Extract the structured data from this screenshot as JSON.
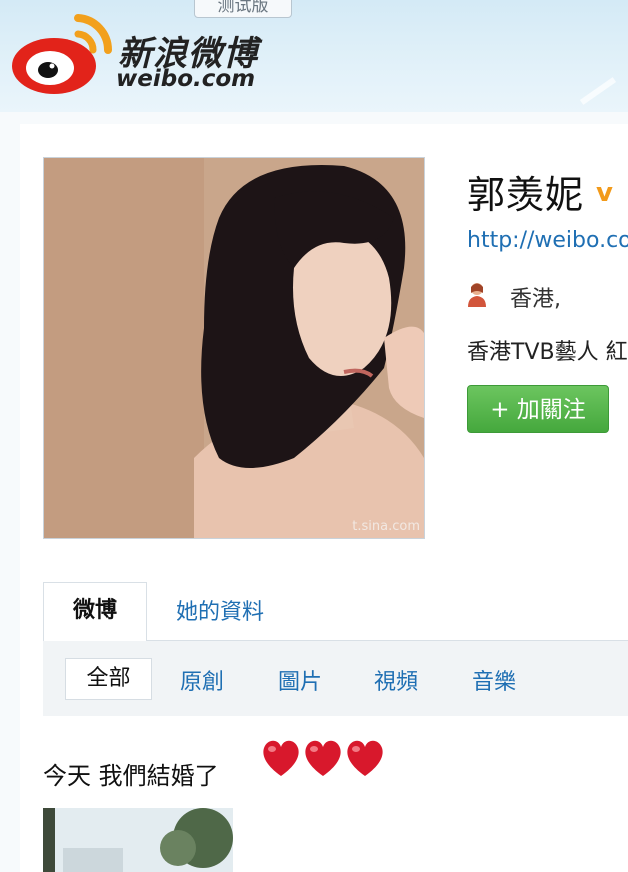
{
  "header": {
    "beta_label": "测试版",
    "logo_cn": "新浪微博",
    "logo_en": "weibo.com"
  },
  "profile": {
    "name": "郭羡妮",
    "url": "http://weibo.co",
    "location": "香港,",
    "bio": "香港TVB藝人 紅",
    "follow_label": "+ 加關注",
    "avatar_watermark": "t.sina.com"
  },
  "tabs": {
    "weibo": "微博",
    "profile": "她的資料"
  },
  "filters": [
    "全部",
    "原創",
    "圖片",
    "視頻",
    "音樂"
  ],
  "post": {
    "text": "今天 我們結婚了"
  },
  "colors": {
    "link": "#1f6fb3",
    "follow_green": "#45a83d",
    "verified_orange": "#f29a1a",
    "heart_red": "#d8182c"
  }
}
